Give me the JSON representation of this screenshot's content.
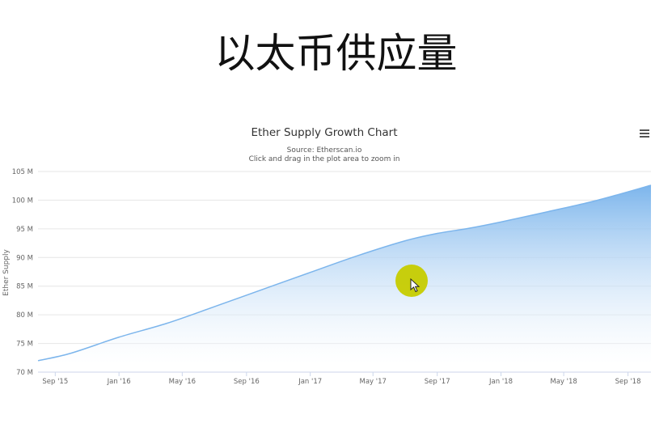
{
  "slide": {
    "title": "以太币供应量"
  },
  "chart_data": {
    "type": "area",
    "title": "Ether Supply Growth Chart",
    "subtitle_lines": [
      "Source: Etherscan.io",
      "Click and drag in the plot area to zoom in"
    ],
    "xlabel": "",
    "ylabel": "Ether Supply",
    "x_ticks": [
      "Sep '15",
      "Jan '16",
      "May '16",
      "Sep '16",
      "Jan '17",
      "May '17",
      "Sep '17",
      "Jan '18",
      "May '18",
      "Sep '18"
    ],
    "y_ticks": [
      "70 M",
      "75 M",
      "80 M",
      "85 M",
      "90 M",
      "95 M",
      "100 M",
      "105 M"
    ],
    "ylim": [
      70,
      105
    ],
    "xlim": [
      "2015-07-30",
      "2018-10-15"
    ],
    "grid": true,
    "colors": {
      "line": "#7cb5ec",
      "area_top": "#7cb5ec",
      "area_bottom": "#ffffff"
    },
    "series": [
      {
        "values_unit": "millions of ETH",
        "x": [
          "2015-07-30",
          "2015-10-01",
          "2016-01-01",
          "2016-04-01",
          "2016-07-01",
          "2016-10-01",
          "2017-01-01",
          "2017-04-01",
          "2017-07-01",
          "2017-09-01",
          "2017-11-01",
          "2018-01-01",
          "2018-04-01",
          "2018-07-01",
          "2018-10-15"
        ],
        "values": [
          72.0,
          73.3,
          76.1,
          78.5,
          81.4,
          84.4,
          87.4,
          90.3,
          92.9,
          94.2,
          95.1,
          96.2,
          98.0,
          99.9,
          102.6
        ]
      }
    ]
  },
  "ui": {
    "menu_icon": "hamburger-menu-icon",
    "cursor_highlight_color": "#c6cc00"
  }
}
